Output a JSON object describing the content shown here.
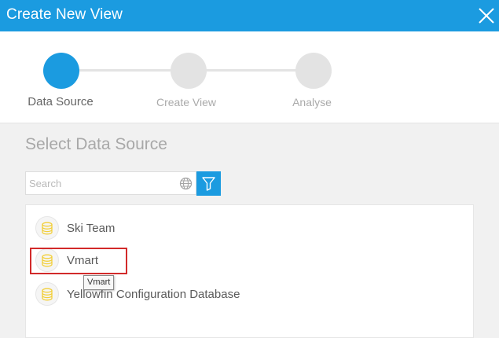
{
  "dialog": {
    "title": "Create New View",
    "close_icon": "close-icon"
  },
  "stepper": {
    "steps": [
      {
        "label": "Data Source",
        "active": true
      },
      {
        "label": "Create View",
        "active": false
      },
      {
        "label": "Analyse",
        "active": false
      }
    ]
  },
  "main": {
    "section_title": "Select Data Source",
    "search": {
      "placeholder": "Search",
      "value": "",
      "globe_icon": "globe-icon",
      "filter_icon": "filter-icon"
    },
    "data_sources": [
      {
        "label": "Ski Team",
        "icon": "database-icon"
      },
      {
        "label": "Vmart",
        "icon": "database-icon"
      },
      {
        "label": "Yellowfin Configuration Database",
        "icon": "database-icon"
      }
    ],
    "tooltip": "Vmart"
  },
  "colors": {
    "accent": "#1b9be0",
    "highlight_border": "#d22a2a",
    "db_icon": "#f2cf3a"
  }
}
